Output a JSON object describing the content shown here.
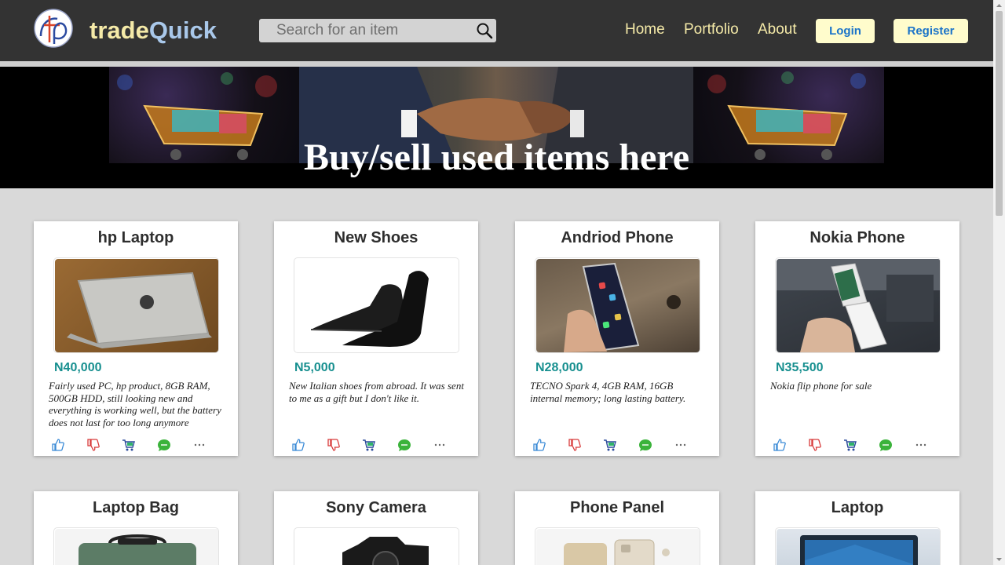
{
  "header": {
    "brand_part1": "trade",
    "brand_part2": "Quick",
    "search_placeholder": "Search for an item",
    "nav": [
      "Home",
      "Portfolio",
      "About"
    ],
    "login_label": "Login",
    "register_label": "Register"
  },
  "hero": {
    "title": "Buy/sell used items here"
  },
  "cards": [
    {
      "title": "hp Laptop",
      "price": "N40,000",
      "description": "Fairly used PC, hp product, 8GB RAM, 500GB HDD, still looking new and everything is working well, but the battery does not last for too long anymore"
    },
    {
      "title": "New Shoes",
      "price": "N5,000",
      "description": "New Italian shoes from abroad. It was sent to me as a gift but I don't like it."
    },
    {
      "title": "Andriod Phone",
      "price": "N28,000",
      "description": "TECNO Spark 4, 4GB RAM, 16GB internal memory; long lasting battery."
    },
    {
      "title": "Nokia Phone",
      "price": "N35,500",
      "description": "Nokia flip phone for sale"
    },
    {
      "title": "Laptop Bag"
    },
    {
      "title": "Sony Camera"
    },
    {
      "title": "Phone Panel"
    },
    {
      "title": "Laptop"
    }
  ],
  "action_icons": [
    "thumbs-up-icon",
    "thumbs-down-icon",
    "cart-icon",
    "chat-icon",
    "more-icon"
  ],
  "colors": {
    "header_bg": "#333333",
    "brand_trade": "#f5eaa8",
    "brand_quick": "#a9c8ea",
    "nav_text": "#f5eaa8",
    "button_bg": "#fffccc",
    "button_text": "#1a73c9",
    "price": "#178f8f",
    "page_bg": "#d9d9d9"
  }
}
